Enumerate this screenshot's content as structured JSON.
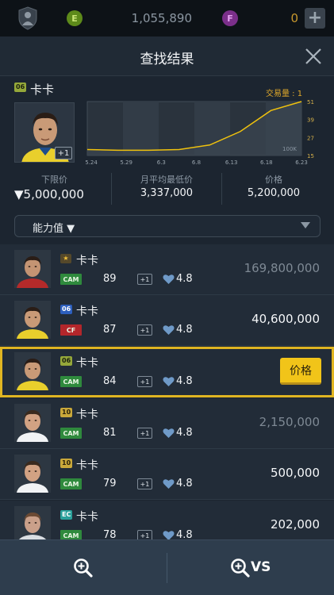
{
  "topbar": {
    "coin_e_symbol": "E",
    "coin_e_value": "1,055,890",
    "coin_f_symbol": "F",
    "coin_f_value": "0",
    "add_label": "+"
  },
  "header": {
    "title": "查找结果"
  },
  "summary": {
    "season_badge": "06",
    "player_name": "卡卡",
    "enhance_label": "+1",
    "trade_volume": "交易量 : 1",
    "floor_price_label": "下限价",
    "floor_price_value": "▼5,000,000",
    "avg_low_label": "月平均最低价",
    "avg_low_value": "3,337,000",
    "price_label": "价格",
    "price_value": "5,200,000"
  },
  "chart_data": {
    "type": "area",
    "categories": [
      "5.24",
      "5.29",
      "6.3",
      "6.8",
      "6.13",
      "6.18",
      "6.23"
    ],
    "values": [
      19,
      18.5,
      18.5,
      19,
      22,
      31,
      45,
      51
    ],
    "y_ticks": [
      "51",
      "39",
      "27",
      "15"
    ],
    "unit_label": "100K",
    "ylim": [
      15,
      51
    ],
    "colors": {
      "line": "#f0c20d",
      "fill": "#3b4650"
    }
  },
  "filter": {
    "label": "能力值 ▼"
  },
  "rows": [
    {
      "badge": "★",
      "badge_class": "sb-star",
      "name": "卡卡",
      "position": "CAM",
      "pos_class": "pos-cam",
      "ovr": "89",
      "enhance": "+1",
      "rating": "4.8",
      "price": "169,800,000",
      "price_class": "price-dim"
    },
    {
      "badge": "06",
      "badge_class": "sb-06b",
      "name": "卡卡",
      "position": "CF",
      "pos_class": "pos-cf",
      "ovr": "87",
      "enhance": "+1",
      "rating": "4.8",
      "price": "40,600,000",
      "price_class": "price-bright"
    },
    {
      "badge": "06",
      "badge_class": "sb-06",
      "name": "卡卡",
      "position": "CAM",
      "pos_class": "pos-cam",
      "ovr": "84",
      "enhance": "+1",
      "rating": "4.8",
      "price_button": "价格"
    },
    {
      "badge": "10",
      "badge_class": "sb-10",
      "name": "卡卡",
      "position": "CAM",
      "pos_class": "pos-cam",
      "ovr": "81",
      "enhance": "+1",
      "rating": "4.8",
      "price": "2,150,000",
      "price_class": "price-dim"
    },
    {
      "badge": "10",
      "badge_class": "sb-10",
      "name": "卡卡",
      "position": "CAM",
      "pos_class": "pos-cam",
      "ovr": "79",
      "enhance": "+1",
      "rating": "4.8",
      "price": "500,000",
      "price_class": "price-bright"
    },
    {
      "badge": "EC",
      "badge_class": "sb-ec",
      "name": "卡卡",
      "position": "CAM",
      "pos_class": "pos-cam",
      "ovr": "78",
      "enhance": "+1",
      "rating": "4.8",
      "price": "202,000",
      "price_class": "price-bright"
    }
  ],
  "bottombar": {
    "vs_label": "VS"
  }
}
